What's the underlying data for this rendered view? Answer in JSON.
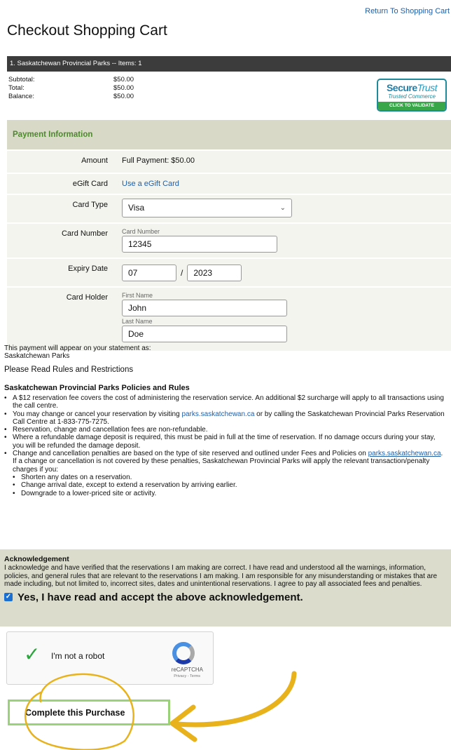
{
  "header": {
    "return_link": "Return To Shopping Cart",
    "title": "Checkout Shopping Cart"
  },
  "cart": {
    "park_bar": "1. Saskatchewan Provincial Parks -- Items: 1",
    "summary": [
      {
        "label": "Subtotal:",
        "value": "$50.00"
      },
      {
        "label": "Total:",
        "value": "$50.00"
      },
      {
        "label": "Balance:",
        "value": "$50.00"
      }
    ]
  },
  "trust_badge": {
    "secure": "Secure",
    "trust": "Trust",
    "tagline": "Trusted Commerce",
    "validate": "CLICK TO VALIDATE"
  },
  "payment": {
    "header": "Payment Information",
    "amount_label": "Amount",
    "amount_value": "Full Payment: $50.00",
    "egift_label": "eGift Card",
    "egift_link": "Use a eGift Card",
    "card_type_label": "Card Type",
    "card_type_value": "Visa",
    "card_number_label": "Card Number",
    "card_number_placeholder": "Card Number",
    "card_number_value": "12345",
    "expiry_label": "Expiry Date",
    "expiry_month": "07",
    "expiry_separator": "/",
    "expiry_year": "2023",
    "holder_label": "Card Holder",
    "first_name_label": "First Name",
    "first_name_value": "John",
    "last_name_label": "Last Name",
    "last_name_value": "Doe"
  },
  "statement": {
    "line1": "This payment will appear on your statement as:",
    "line2": "Saskatchewan Parks",
    "rules": "Please Read Rules and Restrictions"
  },
  "policies": {
    "title": "Saskatchewan Provincial Parks Policies and Rules",
    "p1": "A $12 reservation fee covers the cost of administering the reservation service. An additional $2 surcharge will apply to all transactions using the call centre.",
    "p2_a": "You may change or cancel your reservation by visiting ",
    "p2_link": "parks.saskatchewan.ca",
    "p2_b": " or by calling the Saskatchewan Provincial Parks Reservation Call Centre at 1-833-775-7275.",
    "p3": "Reservation, change and cancellation fees are non-refundable.",
    "p4": "Where a refundable damage deposit is required, this must be paid in full at the time of reservation. If no damage occurs during your stay, you will be refunded the damage deposit.",
    "p5_a": "Change and cancellation penalties are based on the type of site reserved and outlined under Fees and Policies on ",
    "p5_link": "parks.saskatchewan.ca",
    "p5_b": ". If a change or cancellation is not covered by these penalties, Saskatchewan Provincial Parks will apply the relevant transaction/penalty charges if you:",
    "s1": "Shorten any dates on a reservation.",
    "s2": "Change arrival date, except to extend a reservation by arriving earlier.",
    "s3": "Downgrade to a lower-priced site or activity."
  },
  "acknowledgement": {
    "title": "Acknowledgement",
    "text": "I acknowledge and have verified that the reservations I am making are correct. I have read and understood all the warnings, information, policies, and general rules that are relevant to the reservations I am making. I am responsible for any misunderstanding or mistakes that are made including, but not limited to, incorrect sites, dates and unintentional reservations. I agree to pay all associated fees and penalties.",
    "check_label": "Yes, I have read and accept the above acknowledgement."
  },
  "captcha": {
    "label": "I'm not a robot",
    "brand": "reCAPTCHA",
    "links": "Privacy - Terms"
  },
  "purchase_button": "Complete this Purchase",
  "colors": {
    "accent_green": "#4a8a2a",
    "link_blue": "#1f5fa8",
    "annotation_yellow": "#e8b21c"
  }
}
